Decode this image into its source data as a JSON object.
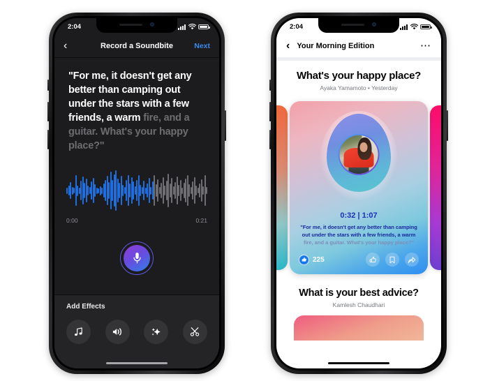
{
  "left_phone": {
    "status_bar": {
      "time": "2:04",
      "signal_icon": "cellular-bars-icon",
      "wifi_icon": "wifi-icon",
      "battery_icon": "battery-icon"
    },
    "navbar": {
      "back_icon": "chevron-left-icon",
      "title": "Record a Soundbite",
      "next_label": "Next",
      "next_color": "#3b8aed"
    },
    "transcript": {
      "spoken": "\"For me, it doesn't get any better than camping out under the stars with a few friends, a warm ",
      "upcoming": "fire, and a guitar. What's your happy place?\""
    },
    "waveform": {
      "start_time": "0:00",
      "end_time": "0:21",
      "played_color": "#1d6fe0",
      "remaining_color": "#6e6e73",
      "progress_ratio": 0.62,
      "bar_heights": [
        9,
        14,
        24,
        11,
        8,
        44,
        15,
        9,
        28,
        40,
        22,
        34,
        14,
        10,
        26,
        36,
        18,
        9,
        7,
        13,
        9,
        20,
        30,
        42,
        24,
        54,
        30,
        46,
        58,
        34,
        22,
        42,
        16,
        10,
        30,
        44,
        20,
        38,
        26,
        12,
        30,
        44,
        16,
        10,
        28,
        9,
        20,
        36,
        11,
        26,
        44,
        18,
        32,
        10,
        22,
        38,
        14,
        28,
        48,
        20,
        36,
        12,
        24,
        40,
        16,
        30,
        9,
        22,
        34,
        44,
        18,
        10,
        26,
        38,
        14,
        8,
        20,
        32,
        12,
        44,
        10
      ]
    },
    "record": {
      "mic_icon": "microphone-icon",
      "gradient_from": "#8e3fd4",
      "gradient_to": "#2f7fe8"
    },
    "effects": {
      "title": "Add Effects",
      "buttons": [
        {
          "icon": "music-note-icon",
          "name": "music"
        },
        {
          "icon": "voice-effect-icon",
          "name": "voice"
        },
        {
          "icon": "sparkles-icon",
          "name": "sparkles"
        },
        {
          "icon": "scissors-icon",
          "name": "trim"
        }
      ]
    }
  },
  "right_phone": {
    "status_bar": {
      "time": "2:04",
      "signal_icon": "cellular-bars-icon",
      "wifi_icon": "wifi-icon",
      "battery_icon": "battery-icon"
    },
    "navbar": {
      "back_icon": "chevron-left-icon",
      "title": "Your Morning Edition",
      "more_icon": "ellipsis-icon"
    },
    "post": {
      "title": "What's your happy place?",
      "author": "Ayaka Yamamoto",
      "separator": "•",
      "date": "Yesterday",
      "meta": "Ayaka Yamamoto • Yesterday"
    },
    "card": {
      "elapsed": "0:32",
      "duration": "1:07",
      "time_display": "0:32 | 1:07",
      "transcript_spoken": "\"For me, it doesn't get any better than camping out under the stars with a few friends, a warm ",
      "transcript_upcoming": "fire, and a guitar. What's your happy place?\"",
      "avatar_name": "avatar",
      "like_count": "225",
      "actions": [
        {
          "icon": "thumbs-up-icon",
          "name": "like"
        },
        {
          "icon": "bookmark-icon",
          "name": "save"
        },
        {
          "icon": "share-arrow-icon",
          "name": "share"
        }
      ]
    },
    "next_post": {
      "title": "What is your best advice?",
      "author": "Kamlesh Chaudhari"
    }
  }
}
